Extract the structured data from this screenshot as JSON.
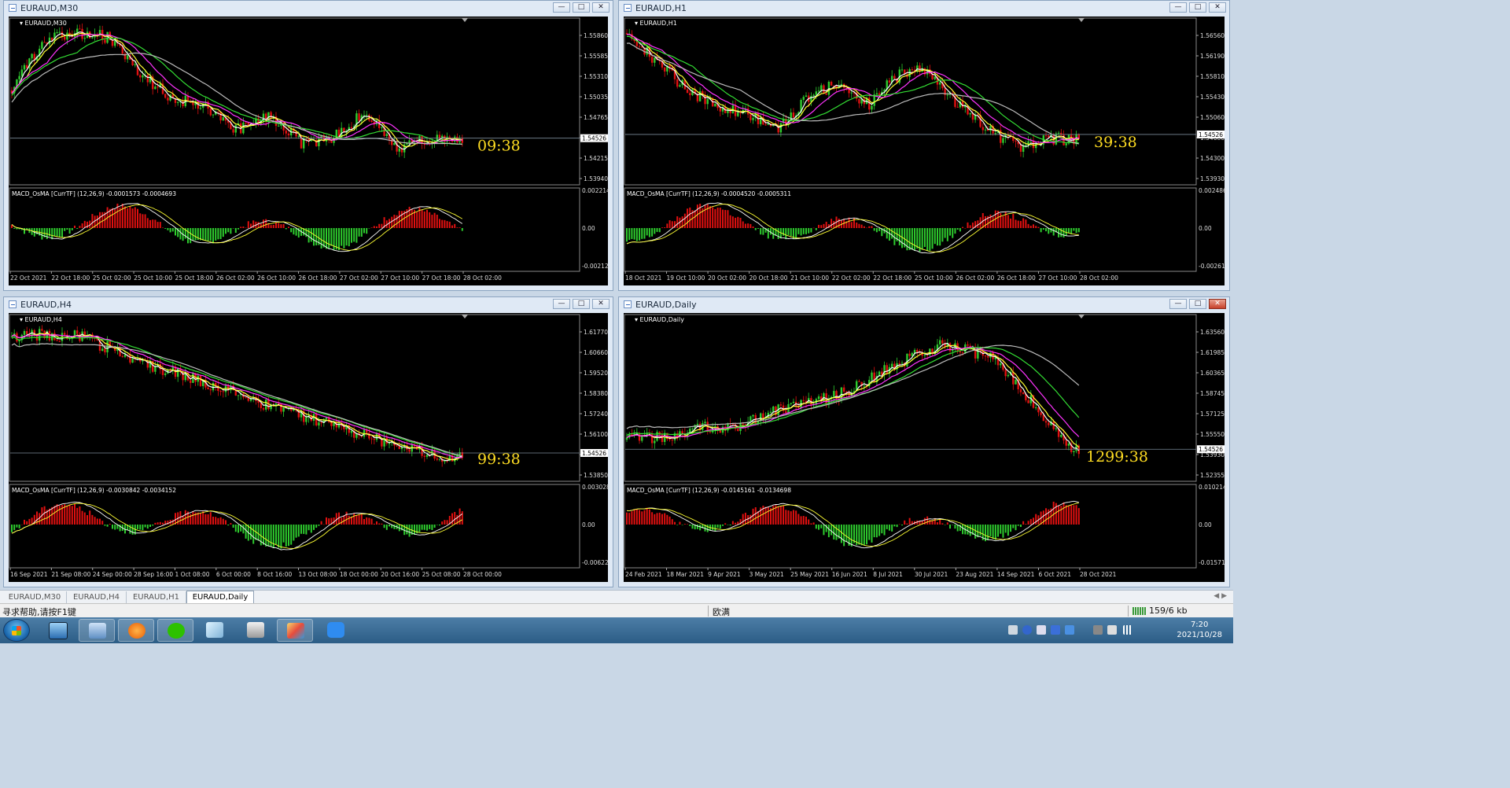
{
  "windows": [
    {
      "id": "m30",
      "title": "EURAUD,M30",
      "chart_label": "EURAUD,M30",
      "price_ticks": [
        "1.55860",
        "1.55585",
        "1.55310",
        "1.55035",
        "1.54765",
        "1.54490",
        "1.54215",
        "1.53940"
      ],
      "current_price": "1.54526",
      "countdown": "09:38",
      "macd_label": "MACD_OsMA [CurrTF] (12,26,9) -0.0001573 -0.0004693",
      "macd_ticks": [
        "0.0022146",
        "0.00",
        "-0.0021246"
      ],
      "time_labels": [
        "22 Oct 2021",
        "22 Oct 18:00",
        "25 Oct 02:00",
        "25 Oct 10:00",
        "25 Oct 18:00",
        "26 Oct 02:00",
        "26 Oct 10:00",
        "26 Oct 18:00",
        "27 Oct 02:00",
        "27 Oct 10:00",
        "27 Oct 18:00",
        "28 Oct 02:00"
      ],
      "red_close": false
    },
    {
      "id": "h1",
      "title": "EURAUD,H1",
      "chart_label": "EURAUD,H1",
      "price_ticks": [
        "1.56560",
        "1.56190",
        "1.55810",
        "1.55430",
        "1.55060",
        "1.54680",
        "1.54300",
        "1.53930"
      ],
      "current_price": "1.54526",
      "countdown": "39:38",
      "macd_label": "MACD_OsMA [CurrTF] (12,26,9) -0.0004520 -0.0005311",
      "macd_ticks": [
        "0.0024869",
        "0.00",
        "-0.0026119"
      ],
      "time_labels": [
        "18 Oct 2021",
        "19 Oct 10:00",
        "20 Oct 02:00",
        "20 Oct 18:00",
        "21 Oct 10:00",
        "22 Oct 02:00",
        "22 Oct 18:00",
        "25 Oct 10:00",
        "26 Oct 02:00",
        "26 Oct 18:00",
        "27 Oct 10:00",
        "28 Oct 02:00"
      ],
      "red_close": false
    },
    {
      "id": "h4",
      "title": "EURAUD,H4",
      "chart_label": "EURAUD,H4",
      "price_ticks": [
        "1.61770",
        "1.60660",
        "1.59520",
        "1.58380",
        "1.57240",
        "1.56100",
        "1.54990",
        "1.53850"
      ],
      "current_price": "1.54526",
      "countdown": "99:38",
      "macd_label": "MACD_OsMA [CurrTF] (12,26,9) -0.0030842 -0.0034152",
      "macd_ticks": [
        "0.0030282",
        "0.00",
        "-0.0062284"
      ],
      "time_labels": [
        "16 Sep 2021",
        "21 Sep 08:00",
        "24 Sep 00:00",
        "28 Sep 16:00",
        "1 Oct 08:00",
        "6 Oct 00:00",
        "8 Oct 16:00",
        "13 Oct 08:00",
        "18 Oct 00:00",
        "20 Oct 16:00",
        "25 Oct 08:00",
        "28 Oct 00:00"
      ],
      "red_close": false
    },
    {
      "id": "daily",
      "title": "EURAUD,Daily",
      "chart_label": "EURAUD,Daily",
      "price_ticks": [
        "1.63560",
        "1.61985",
        "1.60365",
        "1.58745",
        "1.57125",
        "1.55550",
        "1.53930",
        "1.52355"
      ],
      "current_price": "1.54526",
      "countdown": "1299:38",
      "macd_label": "MACD_OsMA [CurrTF] (12,26,9) -0.0145161 -0.0134698",
      "macd_ticks": [
        "0.0102143",
        "0.00",
        "-0.0157197"
      ],
      "time_labels": [
        "24 Feb 2021",
        "18 Mar 2021",
        "9 Apr 2021",
        "3 May 2021",
        "25 May 2021",
        "16 Jun 2021",
        "8 Jul 2021",
        "30 Jul 2021",
        "23 Aug 2021",
        "14 Sep 2021",
        "6 Oct 2021",
        "28 Oct 2021"
      ],
      "red_close": true
    }
  ],
  "tabs": [
    {
      "label": "EURAUD,M30",
      "active": false
    },
    {
      "label": "EURAUD,H4",
      "active": false
    },
    {
      "label": "EURAUD,H1",
      "active": false
    },
    {
      "label": "EURAUD,Daily",
      "active": true
    }
  ],
  "status": {
    "help": "寻求帮助,请按F1键",
    "profile": "欧满",
    "traffic": "159/6 kb"
  },
  "clock": {
    "time": "7:20",
    "date": "2021/10/28"
  },
  "colors": {
    "bull": "#2ecc2e",
    "bear": "#e01010",
    "ma_fast": "#ffffff",
    "ma_yellow": "#ffff33",
    "ma_magenta": "#ff33ff",
    "ma_green": "#33dd33",
    "ma_gray": "#bbbbbb",
    "countdown": "#ffdd22"
  }
}
